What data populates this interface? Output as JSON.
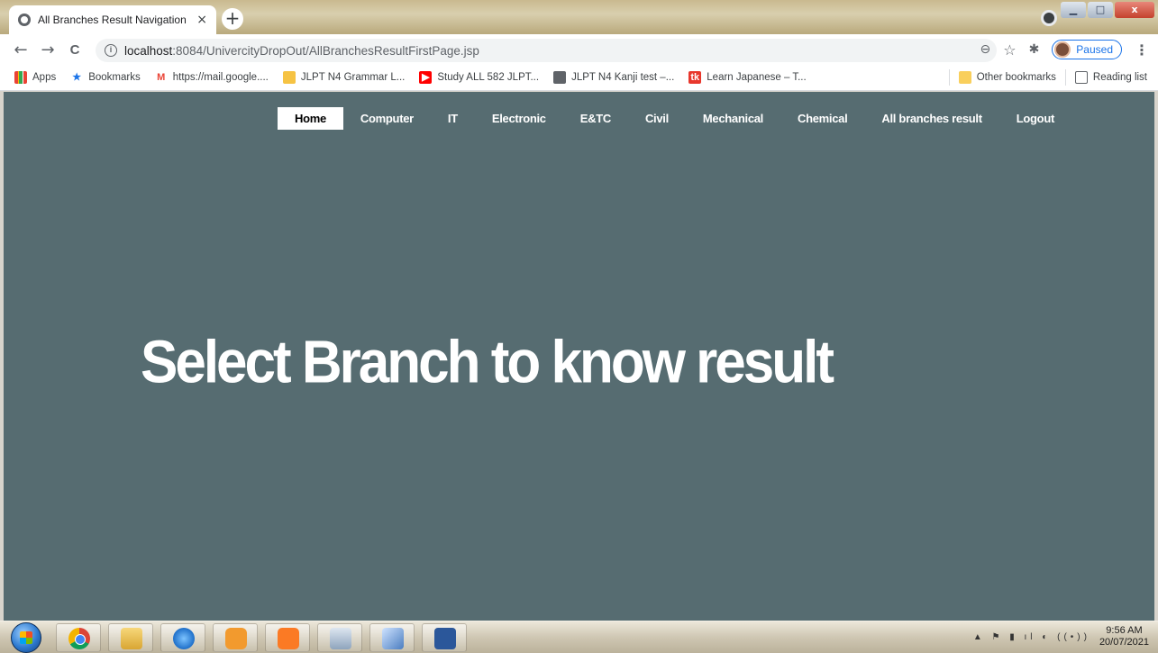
{
  "browser": {
    "tab_title": "All Branches Result Navigation",
    "tab_close": "×",
    "new_tab": "+",
    "url_host": "localhost",
    "url_rest": ":8084/UnivercityDropOut/AllBranchesResultFirstPage.jsp",
    "profile_status": "Paused",
    "window_controls": {
      "min": "▁",
      "max": "□",
      "close": "x"
    },
    "nav": {
      "back": "←",
      "forward": "→",
      "reload": "C",
      "info": "i"
    },
    "toolbar_icons": {
      "zoom": "⊖",
      "star": "☆",
      "extensions": "✱",
      "menu": "⋮"
    }
  },
  "bookmarks": {
    "items": [
      {
        "label": "Apps",
        "icon": "apps-grid-icon"
      },
      {
        "label": "Bookmarks",
        "icon": "star-icon"
      },
      {
        "label": "https://mail.google....",
        "icon": "gmail-icon"
      },
      {
        "label": "JLPT N4 Grammar L...",
        "icon": "jlpt-icon"
      },
      {
        "label": "Study ALL 582 JLPT...",
        "icon": "youtube-icon"
      },
      {
        "label": "JLPT N4 Kanji test –...",
        "icon": "globe-icon"
      },
      {
        "label": "Learn Japanese – T...",
        "icon": "tk-icon"
      }
    ],
    "other": "Other bookmarks",
    "reading_list": "Reading list"
  },
  "page": {
    "nav": [
      {
        "label": "Home",
        "active": true
      },
      {
        "label": "Computer"
      },
      {
        "label": "IT"
      },
      {
        "label": "Electronic"
      },
      {
        "label": "E&TC"
      },
      {
        "label": "Civil"
      },
      {
        "label": "Mechanical"
      },
      {
        "label": "Chemical"
      },
      {
        "label": "All branches result"
      },
      {
        "label": "Logout"
      }
    ],
    "heading": "Select Branch to know result",
    "background": "#566c71"
  },
  "taskbar": {
    "apps": [
      "chrome",
      "explorer",
      "internet-explorer",
      "media-player",
      "xampp",
      "calculator",
      "virtualbox",
      "word"
    ],
    "time": "9:56 AM",
    "date": "20/07/2021"
  }
}
